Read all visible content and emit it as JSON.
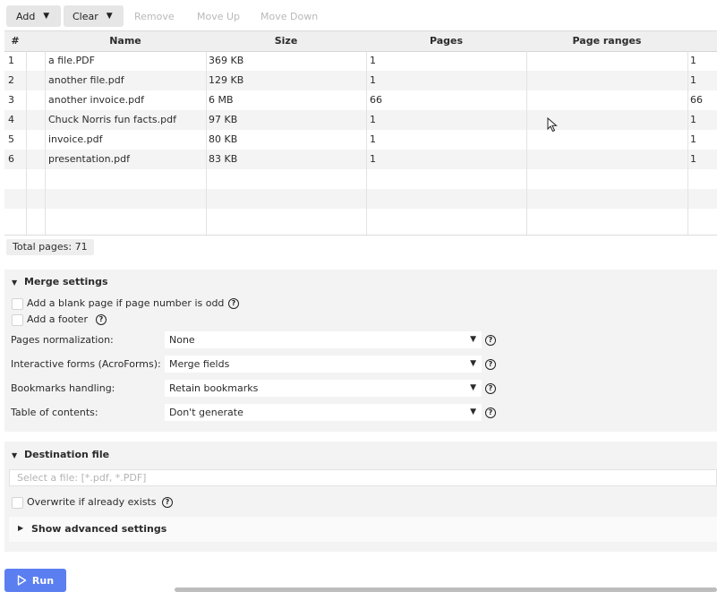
{
  "toolbar": {
    "add": "Add",
    "clear": "Clear",
    "remove": "Remove",
    "move_up": "Move Up",
    "move_down": "Move Down"
  },
  "table": {
    "headers": [
      "#",
      "Name",
      "Size",
      "Pages",
      "Page ranges"
    ],
    "rows": [
      {
        "num": "1",
        "name": "a file.PDF",
        "size": "369 KB",
        "pages": "1",
        "ranges": "1"
      },
      {
        "num": "2",
        "name": "another file.pdf",
        "size": "129 KB",
        "pages": "1",
        "ranges": "1"
      },
      {
        "num": "3",
        "name": "another invoice.pdf",
        "size": "6 MB",
        "pages": "66",
        "ranges": "66"
      },
      {
        "num": "4",
        "name": "Chuck Norris fun facts.pdf",
        "size": "97 KB",
        "pages": "1",
        "ranges": "1"
      },
      {
        "num": "5",
        "name": "invoice.pdf",
        "size": "80 KB",
        "pages": "1",
        "ranges": "1"
      },
      {
        "num": "6",
        "name": "presentation.pdf",
        "size": "83 KB",
        "pages": "1",
        "ranges": "1"
      }
    ]
  },
  "total_pages": "Total pages: 71",
  "merge": {
    "title": "Merge settings",
    "blank_page": "Add a blank page if page number is odd",
    "footer": "Add a footer",
    "normalization_label": "Pages normalization:",
    "normalization_value": "None",
    "forms_label": "Interactive forms (AcroForms):",
    "forms_value": "Merge fields",
    "bookmarks_label": "Bookmarks handling:",
    "bookmarks_value": "Retain bookmarks",
    "toc_label": "Table of contents:",
    "toc_value": "Don't generate"
  },
  "destination": {
    "title": "Destination file",
    "placeholder": "Select a file: [*.pdf, *.PDF]",
    "overwrite": "Overwrite if already exists",
    "advanced": "Show advanced settings"
  },
  "run_label": "Run",
  "icons": {
    "help": "?",
    "dropdown": "▼",
    "expanded": "▼",
    "collapsed": "▶",
    "cursor": "mouse-pointer"
  },
  "colors": {
    "accent": "#5b7ef0",
    "panel": "#f3f3f3"
  }
}
